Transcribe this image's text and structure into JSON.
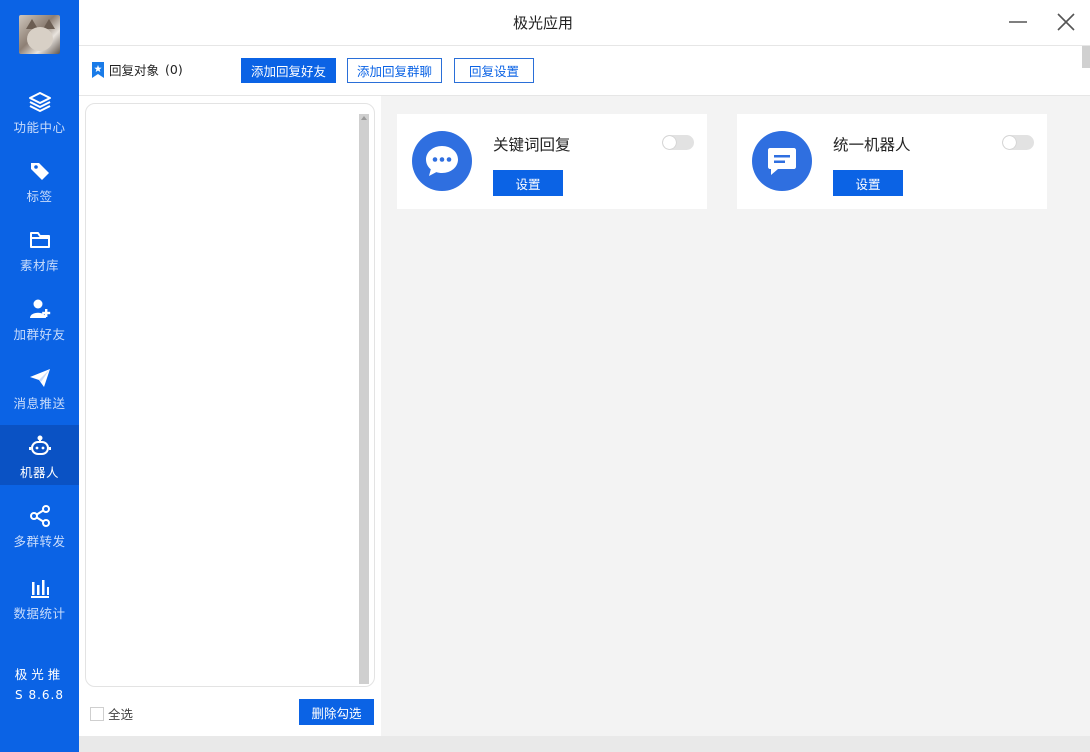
{
  "window": {
    "title": "极光应用"
  },
  "sidebar": {
    "items": [
      {
        "label": "功能中心",
        "icon": "layers-icon"
      },
      {
        "label": "标签",
        "icon": "tag-icon"
      },
      {
        "label": "素材库",
        "icon": "folder-icon"
      },
      {
        "label": "加群好友",
        "icon": "add-user-icon"
      },
      {
        "label": "消息推送",
        "icon": "send-icon"
      },
      {
        "label": "机器人",
        "icon": "robot-icon",
        "active": true
      },
      {
        "label": "多群转发",
        "icon": "share-icon"
      },
      {
        "label": "数据统计",
        "icon": "bar-chart-icon"
      }
    ],
    "brand": "极光推",
    "version": "S 8.6.8"
  },
  "toolbar": {
    "reply_target_label": "回复对象",
    "reply_target_count": "(0)",
    "add_friend_label": "添加回复好友",
    "add_group_label": "添加回复群聊",
    "settings_label": "回复设置"
  },
  "list": {
    "select_all_label": "全选",
    "delete_label": "删除勾选"
  },
  "cards": [
    {
      "name": "关键词回复",
      "button": "设置",
      "icon": "chat-bubble-icon",
      "enabled": false
    },
    {
      "name": "统一机器人",
      "button": "设置",
      "icon": "message-box-icon",
      "enabled": false
    }
  ],
  "colors": {
    "primary": "#0b63e5",
    "sidebar_active": "#0a52c4",
    "card_icon": "#2f6fe0"
  }
}
